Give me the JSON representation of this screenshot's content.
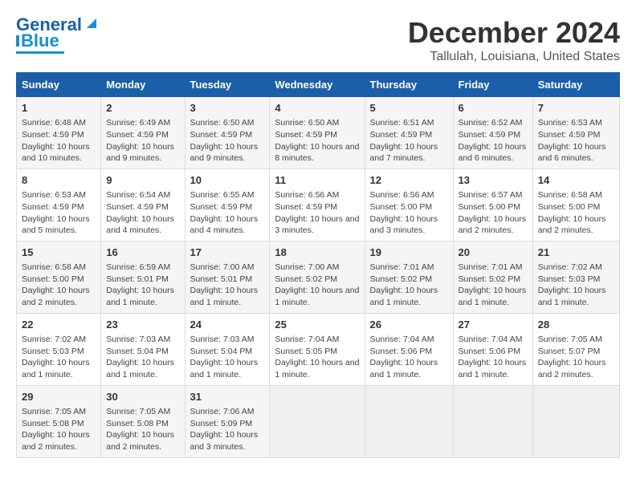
{
  "logo": {
    "line1": "General",
    "line2": "Blue"
  },
  "title": "December 2024",
  "subtitle": "Tallulah, Louisiana, United States",
  "days_header": [
    "Sunday",
    "Monday",
    "Tuesday",
    "Wednesday",
    "Thursday",
    "Friday",
    "Saturday"
  ],
  "weeks": [
    [
      {
        "day": "1",
        "sunrise": "6:48 AM",
        "sunset": "4:59 PM",
        "daylight": "10 hours and 10 minutes."
      },
      {
        "day": "2",
        "sunrise": "6:49 AM",
        "sunset": "4:59 PM",
        "daylight": "10 hours and 9 minutes."
      },
      {
        "day": "3",
        "sunrise": "6:50 AM",
        "sunset": "4:59 PM",
        "daylight": "10 hours and 9 minutes."
      },
      {
        "day": "4",
        "sunrise": "6:50 AM",
        "sunset": "4:59 PM",
        "daylight": "10 hours and 8 minutes."
      },
      {
        "day": "5",
        "sunrise": "6:51 AM",
        "sunset": "4:59 PM",
        "daylight": "10 hours and 7 minutes."
      },
      {
        "day": "6",
        "sunrise": "6:52 AM",
        "sunset": "4:59 PM",
        "daylight": "10 hours and 6 minutes."
      },
      {
        "day": "7",
        "sunrise": "6:53 AM",
        "sunset": "4:59 PM",
        "daylight": "10 hours and 6 minutes."
      }
    ],
    [
      {
        "day": "8",
        "sunrise": "6:53 AM",
        "sunset": "4:59 PM",
        "daylight": "10 hours and 5 minutes."
      },
      {
        "day": "9",
        "sunrise": "6:54 AM",
        "sunset": "4:59 PM",
        "daylight": "10 hours and 4 minutes."
      },
      {
        "day": "10",
        "sunrise": "6:55 AM",
        "sunset": "4:59 PM",
        "daylight": "10 hours and 4 minutes."
      },
      {
        "day": "11",
        "sunrise": "6:56 AM",
        "sunset": "4:59 PM",
        "daylight": "10 hours and 3 minutes."
      },
      {
        "day": "12",
        "sunrise": "6:56 AM",
        "sunset": "5:00 PM",
        "daylight": "10 hours and 3 minutes."
      },
      {
        "day": "13",
        "sunrise": "6:57 AM",
        "sunset": "5:00 PM",
        "daylight": "10 hours and 2 minutes."
      },
      {
        "day": "14",
        "sunrise": "6:58 AM",
        "sunset": "5:00 PM",
        "daylight": "10 hours and 2 minutes."
      }
    ],
    [
      {
        "day": "15",
        "sunrise": "6:58 AM",
        "sunset": "5:00 PM",
        "daylight": "10 hours and 2 minutes."
      },
      {
        "day": "16",
        "sunrise": "6:59 AM",
        "sunset": "5:01 PM",
        "daylight": "10 hours and 1 minute."
      },
      {
        "day": "17",
        "sunrise": "7:00 AM",
        "sunset": "5:01 PM",
        "daylight": "10 hours and 1 minute."
      },
      {
        "day": "18",
        "sunrise": "7:00 AM",
        "sunset": "5:02 PM",
        "daylight": "10 hours and 1 minute."
      },
      {
        "day": "19",
        "sunrise": "7:01 AM",
        "sunset": "5:02 PM",
        "daylight": "10 hours and 1 minute."
      },
      {
        "day": "20",
        "sunrise": "7:01 AM",
        "sunset": "5:02 PM",
        "daylight": "10 hours and 1 minute."
      },
      {
        "day": "21",
        "sunrise": "7:02 AM",
        "sunset": "5:03 PM",
        "daylight": "10 hours and 1 minute."
      }
    ],
    [
      {
        "day": "22",
        "sunrise": "7:02 AM",
        "sunset": "5:03 PM",
        "daylight": "10 hours and 1 minute."
      },
      {
        "day": "23",
        "sunrise": "7:03 AM",
        "sunset": "5:04 PM",
        "daylight": "10 hours and 1 minute."
      },
      {
        "day": "24",
        "sunrise": "7:03 AM",
        "sunset": "5:04 PM",
        "daylight": "10 hours and 1 minute."
      },
      {
        "day": "25",
        "sunrise": "7:04 AM",
        "sunset": "5:05 PM",
        "daylight": "10 hours and 1 minute."
      },
      {
        "day": "26",
        "sunrise": "7:04 AM",
        "sunset": "5:06 PM",
        "daylight": "10 hours and 1 minute."
      },
      {
        "day": "27",
        "sunrise": "7:04 AM",
        "sunset": "5:06 PM",
        "daylight": "10 hours and 1 minute."
      },
      {
        "day": "28",
        "sunrise": "7:05 AM",
        "sunset": "5:07 PM",
        "daylight": "10 hours and 2 minutes."
      }
    ],
    [
      {
        "day": "29",
        "sunrise": "7:05 AM",
        "sunset": "5:08 PM",
        "daylight": "10 hours and 2 minutes."
      },
      {
        "day": "30",
        "sunrise": "7:05 AM",
        "sunset": "5:08 PM",
        "daylight": "10 hours and 2 minutes."
      },
      {
        "day": "31",
        "sunrise": "7:06 AM",
        "sunset": "5:09 PM",
        "daylight": "10 hours and 3 minutes."
      },
      null,
      null,
      null,
      null
    ]
  ],
  "labels": {
    "sunrise": "Sunrise:",
    "sunset": "Sunset:",
    "daylight": "Daylight:"
  }
}
